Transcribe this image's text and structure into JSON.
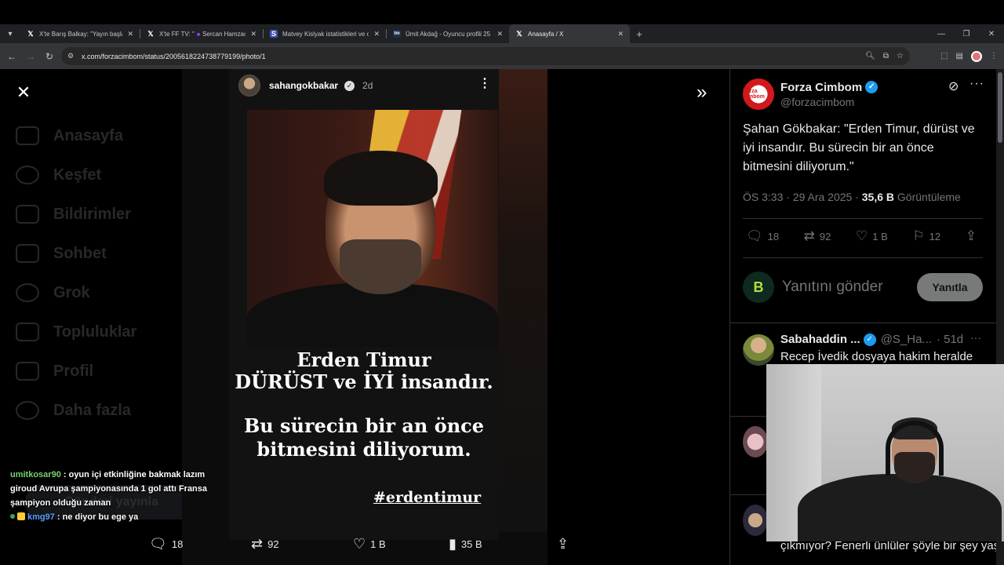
{
  "browser": {
    "tabs": [
      {
        "favicon": "X",
        "title": "X'te Barış Balkay: \"Yayın başladı.",
        "active": false
      },
      {
        "favicon": "X",
        "title": "X'te FF TV: \"",
        "active": false
      },
      {
        "favicon": "twitch",
        "title": "Sercan Hamzaoğ",
        "active": false
      },
      {
        "favicon": "S",
        "title": "Matvey Kislyak istatistikleri ve o",
        "active": false
      },
      {
        "favicon": "tm",
        "title": "Ümit Akdağ - Oyuncu profili 25",
        "active": false
      },
      {
        "favicon": "X",
        "title": "Anasayfa / X",
        "active": true
      }
    ],
    "url": "x.com/forzacimbom/status/2005618224738779199/photo/1",
    "new_tab": "+"
  },
  "bg_sidebar": {
    "items": [
      "Anasayfa",
      "Keşfet",
      "Bildirimler",
      "Sohbet",
      "Grok",
      "Topluluklar",
      "Profil",
      "Daha fazla"
    ],
    "post_button": "Gönderi yayınla"
  },
  "story": {
    "username": "sahangokbakar",
    "time": "2d",
    "line1": "Erden Timur",
    "line2": "DÜRÜST ve İYİ  insandır.",
    "line3": "Bu sürecin bir an önce bitmesini diliyorum.",
    "hashtag": "#erdentimur"
  },
  "media_actions": {
    "replies": "18",
    "reposts": "92",
    "likes": "1 B",
    "views": "35 B"
  },
  "chat": [
    {
      "user": "umitkosar90",
      "text": ": oyun içi etkinliğine bakmak lazım giroud Avrupa şampiyonasında 1 gol attı Fransa şampiyon olduğu zaman"
    },
    {
      "user": "kmg97",
      "text": ": ne diyor bu ege ya"
    }
  ],
  "tweet": {
    "author_name": "Forza Cimbom",
    "author_handle": "@forzacimbom",
    "avatar_text": "Forza Cimbom",
    "text": "Şahan Gökbakar: \"Erden Timur, dürüst ve iyi insandır. Bu sürecin bir an önce bitmesini diliyorum.\"",
    "time": "ÖS 3:33 · 29 Ara 2025 · ",
    "views_count": "35,6 B",
    "views_label": " Görüntüleme",
    "stats": {
      "replies": "18",
      "reposts": "92",
      "likes": "1 B",
      "bookmarks": "12"
    },
    "reply_placeholder": "Yanıtını gönder",
    "reply_button": "Yanıtla"
  },
  "replies": [
    {
      "name": "Sabahaddin ...",
      "handle": "@S_Ha...",
      "time": "· 51d",
      "text": "Recep İvedik dosyaya hakim heralde"
    },
    {
      "text": "çıkmıyor? Fenerli ünlüler şöyle bir şey yaşansa kıyameti koparmıştı"
    }
  ],
  "colors": {
    "accent": "#1d9bf0",
    "chat_user1": "#76d66d",
    "chat_user2": "#5da0ff"
  }
}
